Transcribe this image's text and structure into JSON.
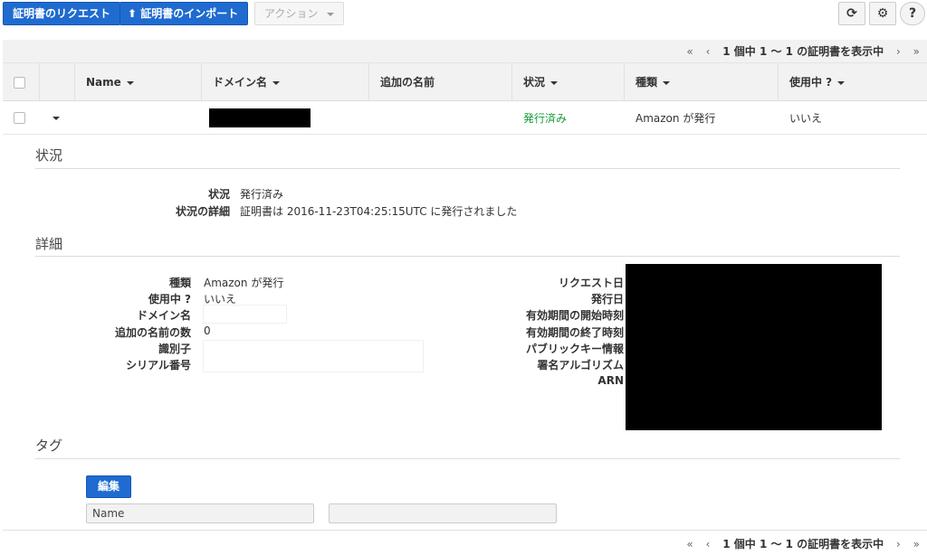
{
  "toolbar": {
    "request_label": "証明書のリクエスト",
    "import_label": "証明書のインポート",
    "actions_label": "アクション",
    "refresh_icon": "refresh-icon",
    "settings_icon": "gear-icon",
    "help_icon": "help-icon"
  },
  "pager": {
    "first": "«",
    "prev": "‹",
    "text": "1 個中 1 ～ 1 の証明書を表示中",
    "next": "›",
    "last": "»"
  },
  "table": {
    "columns": [
      "Name",
      "ドメイン名",
      "追加の名前",
      "状況",
      "種類",
      "使用中 ?"
    ],
    "row": {
      "status": "発行済み",
      "type": "Amazon が発行",
      "in_use": "いいえ"
    }
  },
  "detail": {
    "status_section": "状況",
    "status_label": "状況",
    "status_value": "発行済み",
    "status_detail_label": "状況の詳細",
    "status_detail_value": "証明書は 2016-11-23T04:25:15UTC に発行されました",
    "details_section": "詳細",
    "left": [
      {
        "label": "種類",
        "value": "Amazon が発行"
      },
      {
        "label": "使用中 ?",
        "value": "いいえ"
      },
      {
        "label": "ドメイン名",
        "value": ""
      },
      {
        "label": "追加の名前の数",
        "value": "0"
      },
      {
        "label": "識別子",
        "value": ""
      },
      {
        "label": "シリアル番号",
        "value": ""
      }
    ],
    "right": [
      "リクエスト日",
      "発行日",
      "有効期間の開始時刻",
      "有効期間の終了時刻",
      "パブリックキー情報",
      "署名アルゴリズム",
      "ARN"
    ],
    "tags_section": "タグ",
    "edit_label": "編集",
    "tag_name_placeholder": "Name"
  },
  "colors": {
    "accent": "#1f6bd0",
    "issued": "#1a9c3e"
  }
}
